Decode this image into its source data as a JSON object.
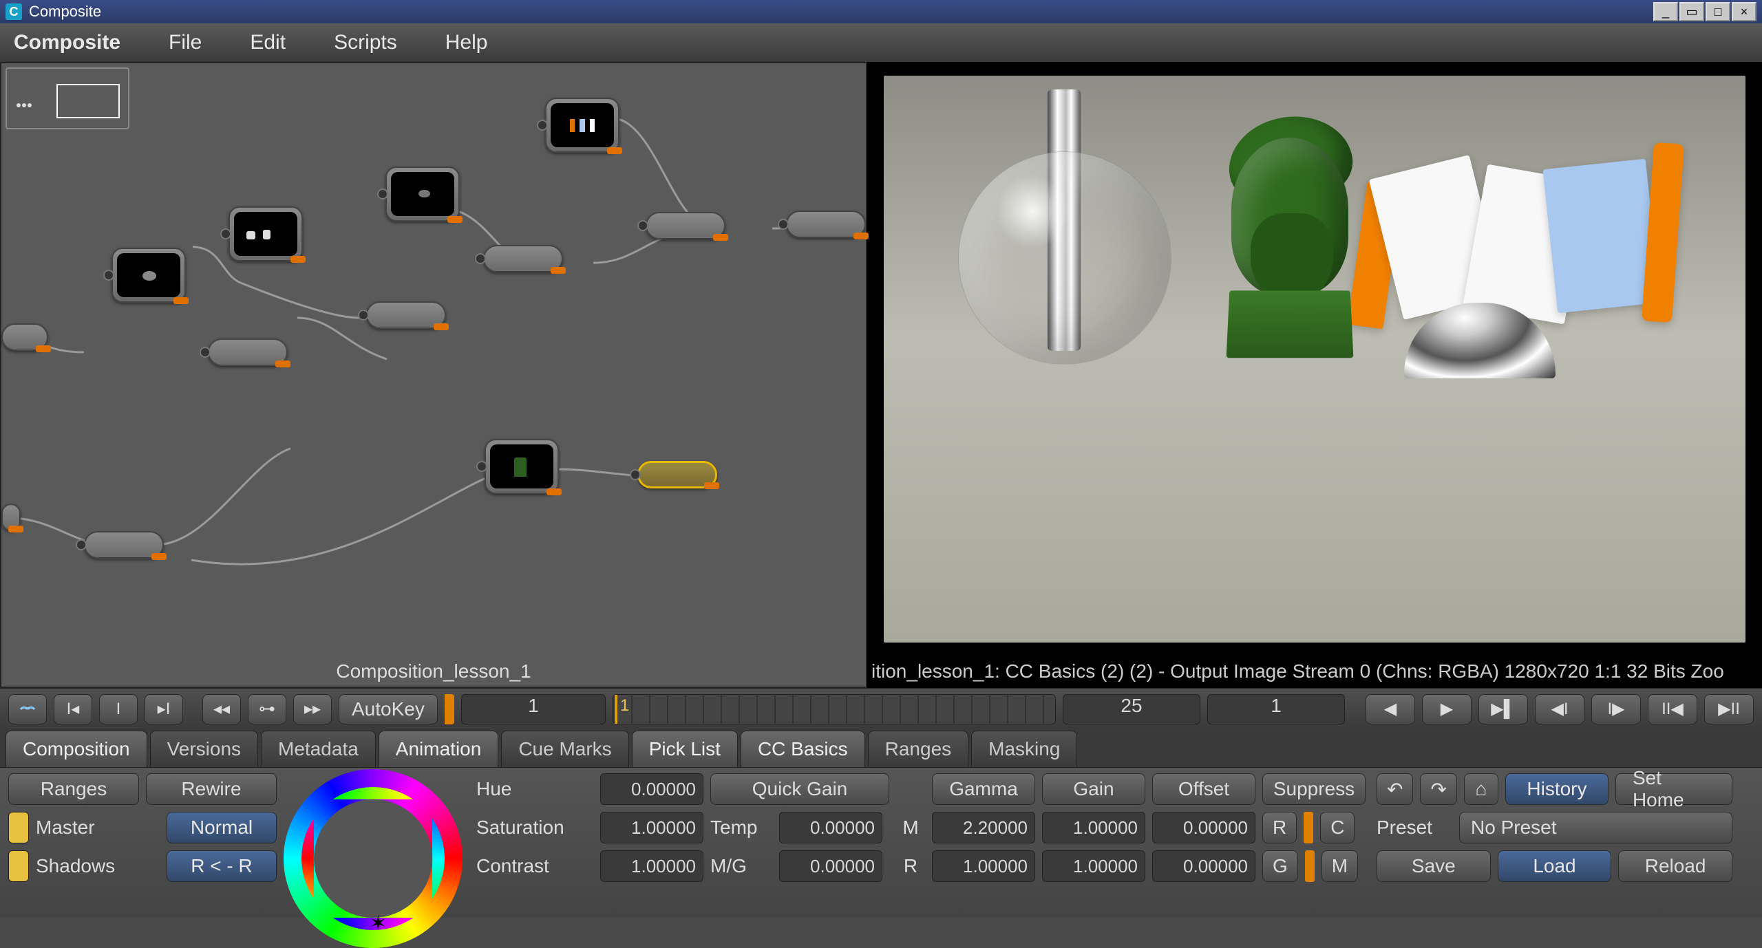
{
  "title_bar": {
    "title": "Composite"
  },
  "menu": {
    "items": [
      "Composite",
      "File",
      "Edit",
      "Scripts",
      "Help"
    ]
  },
  "node_panel": {
    "label": "Composition_lesson_1"
  },
  "viewer": {
    "status": "ition_lesson_1: CC Basics (2) (2) - Output Image  Stream 0 (Chns: RGBA)  1280x720  1:1  32 Bits  Zoo"
  },
  "timeline": {
    "autokey": "AutoKey",
    "frame_current": "1",
    "frame_cursor": "1",
    "frame_end": "25",
    "frame_step": "1"
  },
  "tabs": {
    "items": [
      "Composition",
      "Versions",
      "Metadata",
      "Animation",
      "Cue Marks",
      "Pick List",
      "CC Basics",
      "Ranges",
      "Masking"
    ],
    "active": "CC Basics"
  },
  "cc": {
    "ranges_btn": "Ranges",
    "rewire_btn": "Rewire",
    "master": "Master",
    "shadows": "Shadows",
    "normal": "Normal",
    "rlr": "R < - R",
    "hue_label": "Hue",
    "hue": "0.00000",
    "sat_label": "Saturation",
    "sat": "1.00000",
    "con_label": "Contrast",
    "con": "1.00000",
    "quickgain": "Quick Gain",
    "temp_label": "Temp",
    "temp": "0.00000",
    "mg_label": "M/G",
    "mg": "0.00000",
    "gamma_label": "Gamma",
    "gain_label": "Gain",
    "offset_label": "Offset",
    "suppress_label": "Suppress",
    "m_gamma": "2.20000",
    "m_gain": "1.00000",
    "m_offset": "0.00000",
    "r_gamma": "1.00000",
    "r_gain": "1.00000",
    "r_offset": "0.00000",
    "letters": {
      "m": "M",
      "r": "R",
      "c": "C",
      "g": "G",
      "m2": "M"
    },
    "history": "History",
    "sethome": "Set Home",
    "preset_label": "Preset",
    "preset_value": "No Preset",
    "save": "Save",
    "load": "Load",
    "reload": "Reload"
  }
}
